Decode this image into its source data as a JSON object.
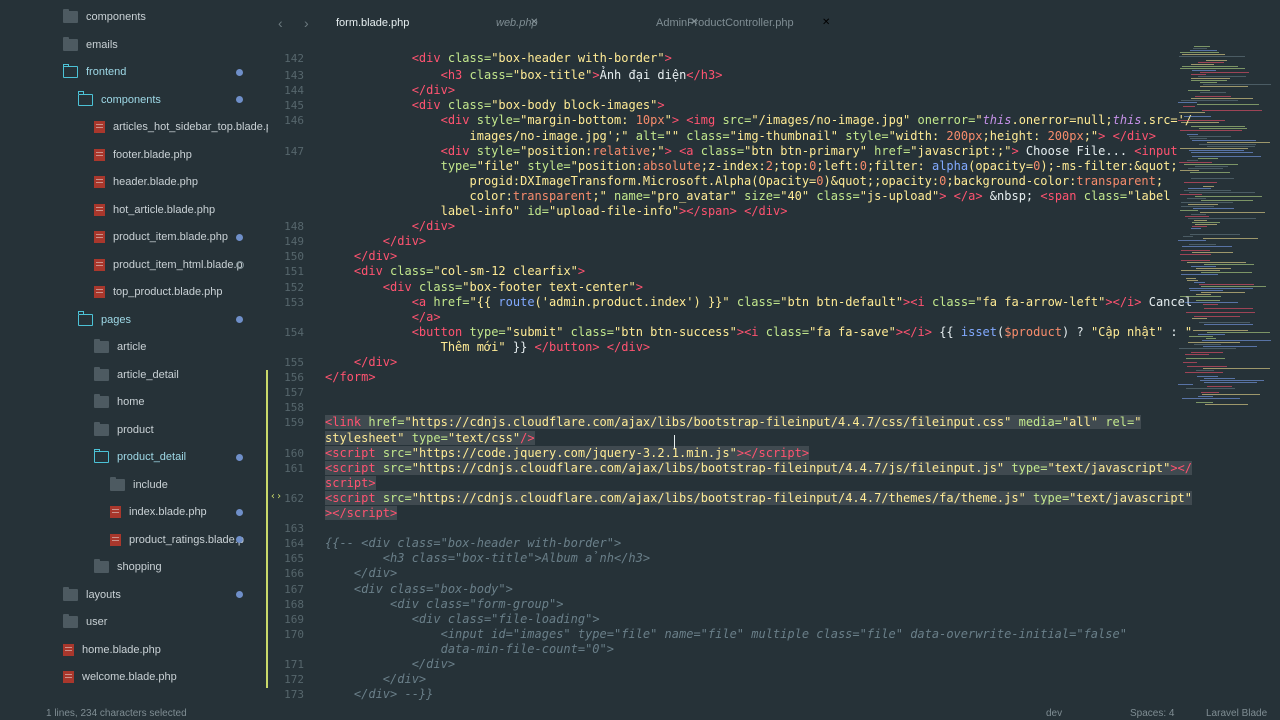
{
  "sidebar": {
    "items": [
      {
        "label": "components",
        "type": "folder",
        "indent": 0,
        "open": false
      },
      {
        "label": "emails",
        "type": "folder",
        "indent": 0,
        "open": false
      },
      {
        "label": "frontend",
        "type": "folder",
        "indent": 0,
        "open": true,
        "modified": true
      },
      {
        "label": "components",
        "type": "folder",
        "indent": 1,
        "open": true,
        "modified": true
      },
      {
        "label": "articles_hot_sidebar_top.blade.ph",
        "type": "file",
        "indent": 2
      },
      {
        "label": "footer.blade.php",
        "type": "file",
        "indent": 2
      },
      {
        "label": "header.blade.php",
        "type": "file",
        "indent": 2
      },
      {
        "label": "hot_article.blade.php",
        "type": "file",
        "indent": 2
      },
      {
        "label": "product_item.blade.php",
        "type": "file",
        "indent": 2,
        "modified": true
      },
      {
        "label": "product_item_html.blade.p",
        "type": "file",
        "indent": 2,
        "untracked": true
      },
      {
        "label": "top_product.blade.php",
        "type": "file",
        "indent": 2
      },
      {
        "label": "pages",
        "type": "folder",
        "indent": 1,
        "open": true,
        "modified": true
      },
      {
        "label": "article",
        "type": "folder",
        "indent": 2,
        "open": false
      },
      {
        "label": "article_detail",
        "type": "folder",
        "indent": 2,
        "open": false
      },
      {
        "label": "home",
        "type": "folder",
        "indent": 2,
        "open": false
      },
      {
        "label": "product",
        "type": "folder",
        "indent": 2,
        "open": false
      },
      {
        "label": "product_detail",
        "type": "folder",
        "indent": 2,
        "open": true,
        "modified": true
      },
      {
        "label": "include",
        "type": "folder",
        "indent": 3,
        "open": false
      },
      {
        "label": "index.blade.php",
        "type": "file",
        "indent": 3,
        "modified": true
      },
      {
        "label": "product_ratings.blade.p",
        "type": "file",
        "indent": 3,
        "modified": true
      },
      {
        "label": "shopping",
        "type": "folder",
        "indent": 2,
        "open": false
      },
      {
        "label": "layouts",
        "type": "folder",
        "indent": 0,
        "open": false,
        "modified": true
      },
      {
        "label": "user",
        "type": "folder",
        "indent": 0,
        "open": false
      },
      {
        "label": "home.blade.php",
        "type": "file",
        "indent": 0
      },
      {
        "label": "welcome.blade.php",
        "type": "file",
        "indent": 0
      }
    ]
  },
  "tabs": [
    {
      "label": "form.blade.php",
      "active": true
    },
    {
      "label": "web.php",
      "active": false,
      "italic": true
    },
    {
      "label": "AdminProductController.php",
      "active": false
    }
  ],
  "editor": {
    "lines": [
      {
        "n": "142",
        "row": -0.1,
        "html": "<span class='tg'>&lt;div</span> <span class='at'>class=</span><span class='st'>\"box-header with-border\"</span><span class='tg'>&gt;</span>",
        "indent": "            "
      },
      {
        "n": "143",
        "row": 1,
        "html": "<span class='tg'>&lt;h3</span> <span class='at'>class=</span><span class='st'>\"box-title\"</span><span class='tg'>&gt;</span>Ảnh đại diện<span class='tg'>&lt;/h3&gt;</span>",
        "indent": "                "
      },
      {
        "n": "144",
        "row": 2,
        "html": "<span class='tg'>&lt;/div&gt;</span>",
        "indent": "            "
      },
      {
        "n": "145",
        "row": 3,
        "html": "<span class='tg'>&lt;div</span> <span class='at'>class=</span><span class='st'>\"box-body block-images\"</span><span class='tg'>&gt;</span>",
        "indent": "            "
      },
      {
        "n": "146",
        "row": 4,
        "html": "<span class='tg'>&lt;div</span> <span class='at'>style=</span><span class='st'>\"margin-bottom: </span><span class='num'>10px</span><span class='st'>\"</span><span class='tg'>&gt;</span> <span class='tg'>&lt;img</span> <span class='at'>src=</span><span class='st'>\"/images/no-image.jpg\"</span> <span class='at'>onerror=</span><span class='st'>\"</span><span class='kw'>this</span><span class='st'>.onerror=null;</span><span class='kw'>this</span><span class='st'>.src='/</span>",
        "indent": "                "
      },
      {
        "n": "",
        "row": 5,
        "html": "<span class='st'>images/no-image.jpg';\"</span> <span class='at'>alt=</span><span class='st'>\"\"</span> <span class='at'>class=</span><span class='st'>\"img-thumbnail\"</span> <span class='at'>style=</span><span class='st'>\"width: </span><span class='num'>200px</span><span class='st'>;height: </span><span class='num'>200px</span><span class='st'>;\"</span><span class='tg'>&gt;</span> <span class='tg'>&lt;/div&gt;</span>",
        "indent": "                    "
      },
      {
        "n": "147",
        "row": 6,
        "html": "<span class='tg'>&lt;div</span> <span class='at'>style=</span><span class='st'>\"position:</span><span class='vr'>relative</span><span class='st'>;\"</span><span class='tg'>&gt;</span> <span class='tg'>&lt;a</span> <span class='at'>class=</span><span class='st'>\"btn btn-primary\"</span> <span class='at'>href=</span><span class='st'>\"javascript:;\"</span><span class='tg'>&gt;</span> Choose File... <span class='tg'>&lt;input</span>",
        "indent": "                "
      },
      {
        "n": "",
        "row": 7,
        "html": "<span class='at'>type=</span><span class='st'>\"file\"</span> <span class='at'>style=</span><span class='st'>\"position:</span><span class='vr'>absolute</span><span class='st'>;z-index:</span><span class='num'>2</span><span class='st'>;top:</span><span class='num'>0</span><span class='st'>;left:</span><span class='num'>0</span><span class='st'>;filter: </span><span class='fn'>alpha</span><span class='st'>(opacity=</span><span class='num'>0</span><span class='st'>);-ms-filter:&amp;quot;</span>",
        "indent": "                "
      },
      {
        "n": "",
        "row": 8,
        "html": "<span class='st'>progid:DXImageTransform.Microsoft.Alpha(Opacity=</span><span class='num'>0</span><span class='st'>)&amp;quot;;opacity:</span><span class='num'>0</span><span class='st'>;background-color:</span><span class='vr'>transparent</span><span class='st'>;</span>",
        "indent": "                    "
      },
      {
        "n": "",
        "row": 9,
        "html": "<span class='st'>color:</span><span class='vr'>transparent</span><span class='st'>;\"</span> <span class='at'>name=</span><span class='st'>\"pro_avatar\"</span> <span class='at'>size=</span><span class='st'>\"40\"</span> <span class='at'>class=</span><span class='st'>\"js-upload\"</span><span class='tg'>&gt;</span> <span class='tg'>&lt;/a&gt;</span> &amp;nbsp; <span class='tg'>&lt;span</span> <span class='at'>class=</span><span class='st'>\"label</span>",
        "indent": "                    "
      },
      {
        "n": "",
        "row": 10,
        "html": "<span class='st'>label-info\"</span> <span class='at'>id=</span><span class='st'>\"upload-file-info\"</span><span class='tg'>&gt;&lt;/span&gt;</span> <span class='tg'>&lt;/div&gt;</span>",
        "indent": "                "
      },
      {
        "n": "148",
        "row": 11,
        "html": "<span class='tg'>&lt;/div&gt;</span>",
        "indent": "            "
      },
      {
        "n": "149",
        "row": 12,
        "html": "<span class='tg'>&lt;/div&gt;</span>",
        "indent": "        "
      },
      {
        "n": "150",
        "row": 13,
        "html": "<span class='tg'>&lt;/div&gt;</span>",
        "indent": "    "
      },
      {
        "n": "151",
        "row": 14,
        "html": "<span class='tg'>&lt;div</span> <span class='at'>class=</span><span class='st'>\"col-sm-12 clearfix\"</span><span class='tg'>&gt;</span>",
        "indent": "    "
      },
      {
        "n": "152",
        "row": 15,
        "html": "<span class='tg'>&lt;div</span> <span class='at'>class=</span><span class='st'>\"box-footer text-center\"</span><span class='tg'>&gt;</span>",
        "indent": "        "
      },
      {
        "n": "153",
        "row": 16,
        "html": "<span class='tg'>&lt;a</span> <span class='at'>href=</span><span class='st'>\"{{ </span><span class='fn'>route</span><span class='st'>('admin.product.index') }}\"</span> <span class='at'>class=</span><span class='st'>\"btn btn-default\"</span><span class='tg'>&gt;&lt;i</span> <span class='at'>class=</span><span class='st'>\"fa fa-arrow-left\"</span><span class='tg'>&gt;&lt;/i&gt;</span> Cancel",
        "indent": "            "
      },
      {
        "n": "",
        "row": 17,
        "html": "<span class='tg'>&lt;/a&gt;</span>",
        "indent": "            "
      },
      {
        "n": "154",
        "row": 18,
        "html": "<span class='tg'>&lt;button</span> <span class='at'>type=</span><span class='st'>\"submit\"</span> <span class='at'>class=</span><span class='st'>\"btn btn-success\"</span><span class='tg'>&gt;&lt;i</span> <span class='at'>class=</span><span class='st'>\"fa fa-save\"</span><span class='tg'>&gt;&lt;/i&gt;</span> {{ <span class='fn'>isset</span>(<span class='vr'>$product</span>) ? <span class='st'>\"Cập nhật\"</span> : <span class='st'>\"</span>",
        "indent": "            "
      },
      {
        "n": "",
        "row": 19,
        "html": "<span class='st'>Thêm mới\"</span> }} <span class='tg'>&lt;/button&gt;</span> <span class='tg'>&lt;/div&gt;</span>",
        "indent": "                "
      },
      {
        "n": "155",
        "row": 20,
        "html": "<span class='tg'>&lt;/div&gt;</span>",
        "indent": "    "
      },
      {
        "n": "156",
        "row": 21,
        "html": "<span class='tg'>&lt;/form&gt;</span>",
        "indent": ""
      },
      {
        "n": "157",
        "row": 22,
        "html": "",
        "indent": ""
      },
      {
        "n": "158",
        "row": 23,
        "html": "",
        "indent": ""
      },
      {
        "n": "159",
        "row": 24,
        "html": "<span class='sel'><span class='tg'>&lt;link</span> <span class='at'>href=</span><span class='st'>\"https://cdnjs.cloudflare.com/ajax/libs/bootstrap-fileinput/4.4.7/css/fileinput.css\"</span> <span class='at'>media=</span><span class='st'>\"all\"</span> <span class='at'>rel=</span><span class='st'>\"</span></span>",
        "indent": ""
      },
      {
        "n": "",
        "row": 25,
        "html": "<span class='sel'><span class='st'>stylesheet\"</span> <span class='at'>type=</span><span class='st'>\"text/css\"</span><span class='tg'>/&gt;</span></span>",
        "indent": ""
      },
      {
        "n": "160",
        "row": 26,
        "html": "<span class='sel'><span class='tg'>&lt;script</span> <span class='at'>src=</span><span class='st'>\"https://code.jquery.com/jquery-3.2.1.min.js\"</span><span class='tg'>&gt;&lt;/script&gt;</span></span>",
        "indent": ""
      },
      {
        "n": "161",
        "row": 27,
        "html": "<span class='sel'><span class='tg'>&lt;script</span> <span class='at'>src=</span><span class='st'>\"https://cdnjs.cloudflare.com/ajax/libs/bootstrap-fileinput/4.4.7/js/fileinput.js\"</span> <span class='at'>type=</span><span class='st'>\"text/javascript\"</span><span class='tg'>&gt;&lt;/</span></span>",
        "indent": ""
      },
      {
        "n": "",
        "row": 28,
        "html": "<span class='sel'><span class='tg'>script&gt;</span></span>",
        "indent": ""
      },
      {
        "n": "162",
        "row": 29,
        "html": "<span class='sel'><span class='tg'>&lt;script</span> <span class='at'>src=</span><span class='st'>\"https://cdnjs.cloudflare.com/ajax/libs/bootstrap-fileinput/4.4.7/themes/fa/theme.js\"</span> <span class='at'>type=</span><span class='st'>\"text/javascript\"</span></span>",
        "indent": ""
      },
      {
        "n": "",
        "row": 30,
        "html": "<span class='sel'><span class='tg'>&gt;&lt;/script&gt;</span></span>",
        "indent": ""
      },
      {
        "n": "163",
        "row": 31,
        "html": "",
        "indent": ""
      },
      {
        "n": "164",
        "row": 32,
        "html": "<span class='cm'>{{-- &lt;div class=\"box-header with-border\"&gt;</span>",
        "indent": ""
      },
      {
        "n": "165",
        "row": 33,
        "html": "<span class='cm'>&lt;h3 class=\"box-title\"&gt;Album ảnh&lt;/h3&gt;</span>",
        "indent": "        "
      },
      {
        "n": "166",
        "row": 34,
        "html": "<span class='cm'>&lt;/div&gt;</span>",
        "indent": "    "
      },
      {
        "n": "167",
        "row": 35,
        "html": "<span class='cm'>&lt;div class=\"box-body\"&gt;</span>",
        "indent": "    "
      },
      {
        "n": "168",
        "row": 36,
        "html": "<span class='cm'>&lt;div class=\"form-group\"&gt;</span>",
        "indent": "         "
      },
      {
        "n": "169",
        "row": 37,
        "html": "<span class='cm'>&lt;div class=\"file-loading\"&gt;</span>",
        "indent": "            "
      },
      {
        "n": "170",
        "row": 38,
        "html": "<span class='cm'>&lt;input id=\"images\" type=\"file\" name=\"file\" multiple class=\"file\" data-overwrite-initial=\"false\"</span>",
        "indent": "                "
      },
      {
        "n": "",
        "row": 39,
        "html": "<span class='cm'>data-min-file-count=\"0\"&gt;</span>",
        "indent": "                "
      },
      {
        "n": "171",
        "row": 40,
        "html": "<span class='cm'>&lt;/div&gt;</span>",
        "indent": "            "
      },
      {
        "n": "172",
        "row": 41,
        "html": "<span class='cm'>&lt;/div&gt;</span>",
        "indent": "        "
      },
      {
        "n": "173",
        "row": 42,
        "html": "<span class='cm'>&lt;/div&gt; --}}</span>",
        "indent": "    "
      }
    ]
  },
  "statusbar": {
    "selection": "1 lines, 234 characters selected",
    "git": "dev",
    "spaces": "Spaces: 4",
    "syntax": "Laravel Blade"
  }
}
